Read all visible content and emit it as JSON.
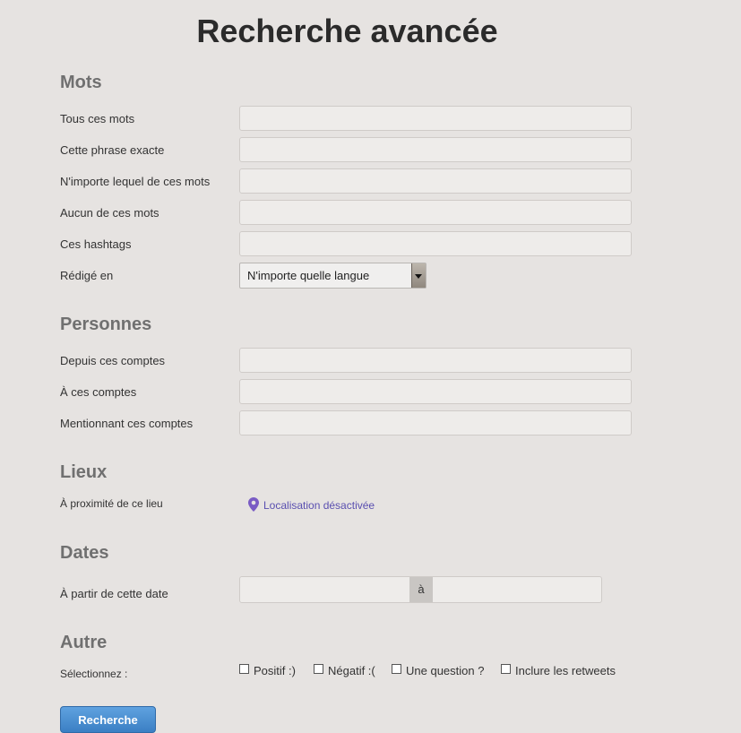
{
  "title": "Recherche avancée",
  "sections": {
    "mots": "Mots",
    "personnes": "Personnes",
    "lieux": "Lieux",
    "dates": "Dates",
    "autre": "Autre"
  },
  "mots": {
    "all_words": "Tous ces mots",
    "exact_phrase": "Cette phrase exacte",
    "any_words": "N'importe lequel de ces mots",
    "none_words": "Aucun de ces mots",
    "hashtags": "Ces hashtags",
    "language_label": "Rédigé en",
    "language_value": "N'importe quelle langue"
  },
  "personnes": {
    "from": "Depuis ces comptes",
    "to": "À ces comptes",
    "mentioning": "Mentionnant ces comptes"
  },
  "lieux": {
    "near_label": "À proximité de ce lieu",
    "location_link": "Localisation désactivée"
  },
  "dates": {
    "from_label": "À partir de cette date",
    "separator": "à"
  },
  "autre": {
    "select_label": "Sélectionnez :",
    "options": [
      "Positif :)",
      "Négatif :(",
      "Une question ?",
      "Inclure les retweets"
    ]
  },
  "search_button": "Recherche",
  "colors": {
    "link": "#5a4fb0",
    "button": "#3b7fc4",
    "pin": "#7a5cc4"
  },
  "icons": {
    "location": "map-pin-icon",
    "dropdown": "chevron-down-icon"
  }
}
